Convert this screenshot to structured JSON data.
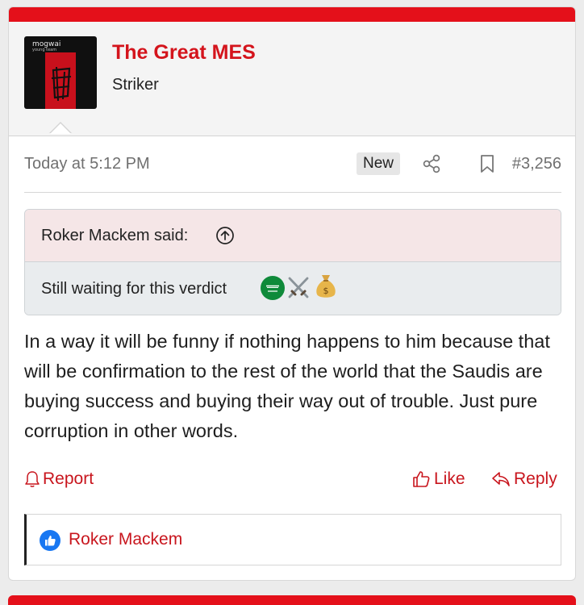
{
  "post": {
    "avatar": {
      "brand_text": "mogwai",
      "brand_subtext": "young team"
    },
    "username": "The Great MES",
    "user_title": "Striker",
    "timestamp": "Today at 5:12 PM",
    "new_badge": "New",
    "post_number": "#3,256",
    "quote": {
      "author_label": "Roker Mackem said:",
      "text": "Still waiting for this verdict",
      "emojis": [
        "saudi-flag-emoji",
        "crossed-swords-emoji",
        "money-bag-emoji"
      ]
    },
    "message": "In a way it will be funny if nothing happens to him because that will be confirmation to the rest of the world that the Saudis are buying success and buying their way out of trouble. Just pure corruption in other words.",
    "actions": {
      "report": "Report",
      "like": "Like",
      "reply": "Reply"
    },
    "reactions": {
      "icon": "thumbs-up-icon",
      "users": "Roker Mackem"
    }
  },
  "colors": {
    "accent": "#d4141c",
    "bar_red": "#e4101a",
    "quote_head_bg": "#f5e6e7",
    "quote_body_bg": "#e9ecee",
    "like_blue": "#1877f2"
  }
}
